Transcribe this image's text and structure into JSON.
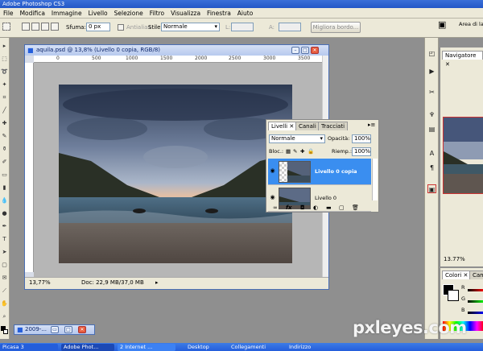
{
  "app": {
    "title": "Adobe Photoshop CS3"
  },
  "menu": [
    "File",
    "Modifica",
    "Immagine",
    "Livello",
    "Selezione",
    "Filtro",
    "Visualizza",
    "Finestra",
    "Aiuto"
  ],
  "options": {
    "sfuma_label": "Sfuma:",
    "sfuma_value": "0 px",
    "antialias_label": "Antialias",
    "stile_label": "Stile:",
    "stile_value": "Normale",
    "l_label": "L:",
    "a_label": "A:",
    "migliora_button": "Migliora bordo...",
    "workspace_label": "Area di lavoro"
  },
  "document": {
    "title": "aquila.psd @ 13,8% (Livello 0 copia, RGB/8)",
    "ruler_ticks": [
      "0",
      "500",
      "1000",
      "1500",
      "2000",
      "2500",
      "3000",
      "3500"
    ],
    "zoom": "13,77%",
    "doc_info": "Doc: 22,9 MB/37,0 MB"
  },
  "layers_panel": {
    "tabs": [
      "Livelli",
      "Canali",
      "Tracciati"
    ],
    "blend_mode": "Normale",
    "opacity_label": "Opacità:",
    "opacity_value": "100%",
    "lock_label": "Bloc.:",
    "fill_label": "Riemp.:",
    "fill_value": "100%",
    "layers": [
      {
        "name": "Livello 0 copia",
        "selected": true
      },
      {
        "name": "Livello 0",
        "selected": false
      }
    ],
    "fx_label": "fx"
  },
  "navigator": {
    "tab": "Navigatore",
    "zoom": "13.77%"
  },
  "color_panel": {
    "tabs": [
      "Colori",
      "Cam"
    ],
    "channels": [
      "R",
      "G",
      "B"
    ]
  },
  "minimized_doc": {
    "title": "2009-..."
  },
  "taskbar": [
    "Picasa 3",
    "Adobe Phot...",
    "2 Internet ...",
    "Desktop",
    "Collegamenti",
    "Indirizzo"
  ],
  "watermark": "pxleyes.com",
  "colors": {
    "selection": "#3a8ef0",
    "title_blue": "#245edb",
    "panel_bg": "#ece9d8"
  }
}
